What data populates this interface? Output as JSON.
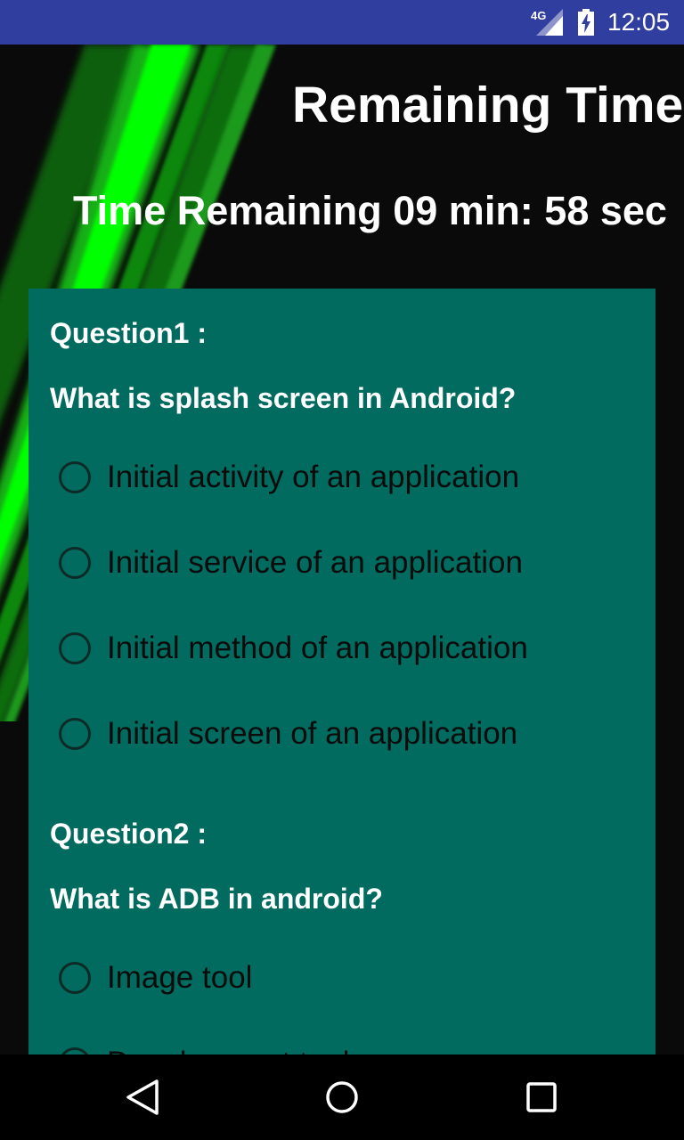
{
  "status_bar": {
    "network": "4G",
    "time": "12:05",
    "icons": [
      "signal-icon",
      "battery-charging-icon"
    ]
  },
  "header": {
    "title": "Remaining Time",
    "timer_text": "Time Remaining 09 min: 58 sec"
  },
  "quiz": {
    "questions": [
      {
        "label": "Question1 :",
        "text": "What is splash screen in Android?",
        "options": [
          "Initial activity of an application",
          "Initial service of an application",
          "Initial method of an application",
          "Initial screen of an application"
        ]
      },
      {
        "label": "Question2 :",
        "text": "What is ADB in android?",
        "options": [
          "Image tool",
          "Development tool"
        ]
      }
    ]
  },
  "nav_bar": {
    "buttons": [
      "back-icon",
      "home-icon",
      "recents-icon"
    ]
  },
  "colors": {
    "status_bar": "#303f9f",
    "card": "#006b5e",
    "background": "#0a0a0a",
    "stripe": "#00ff00"
  }
}
